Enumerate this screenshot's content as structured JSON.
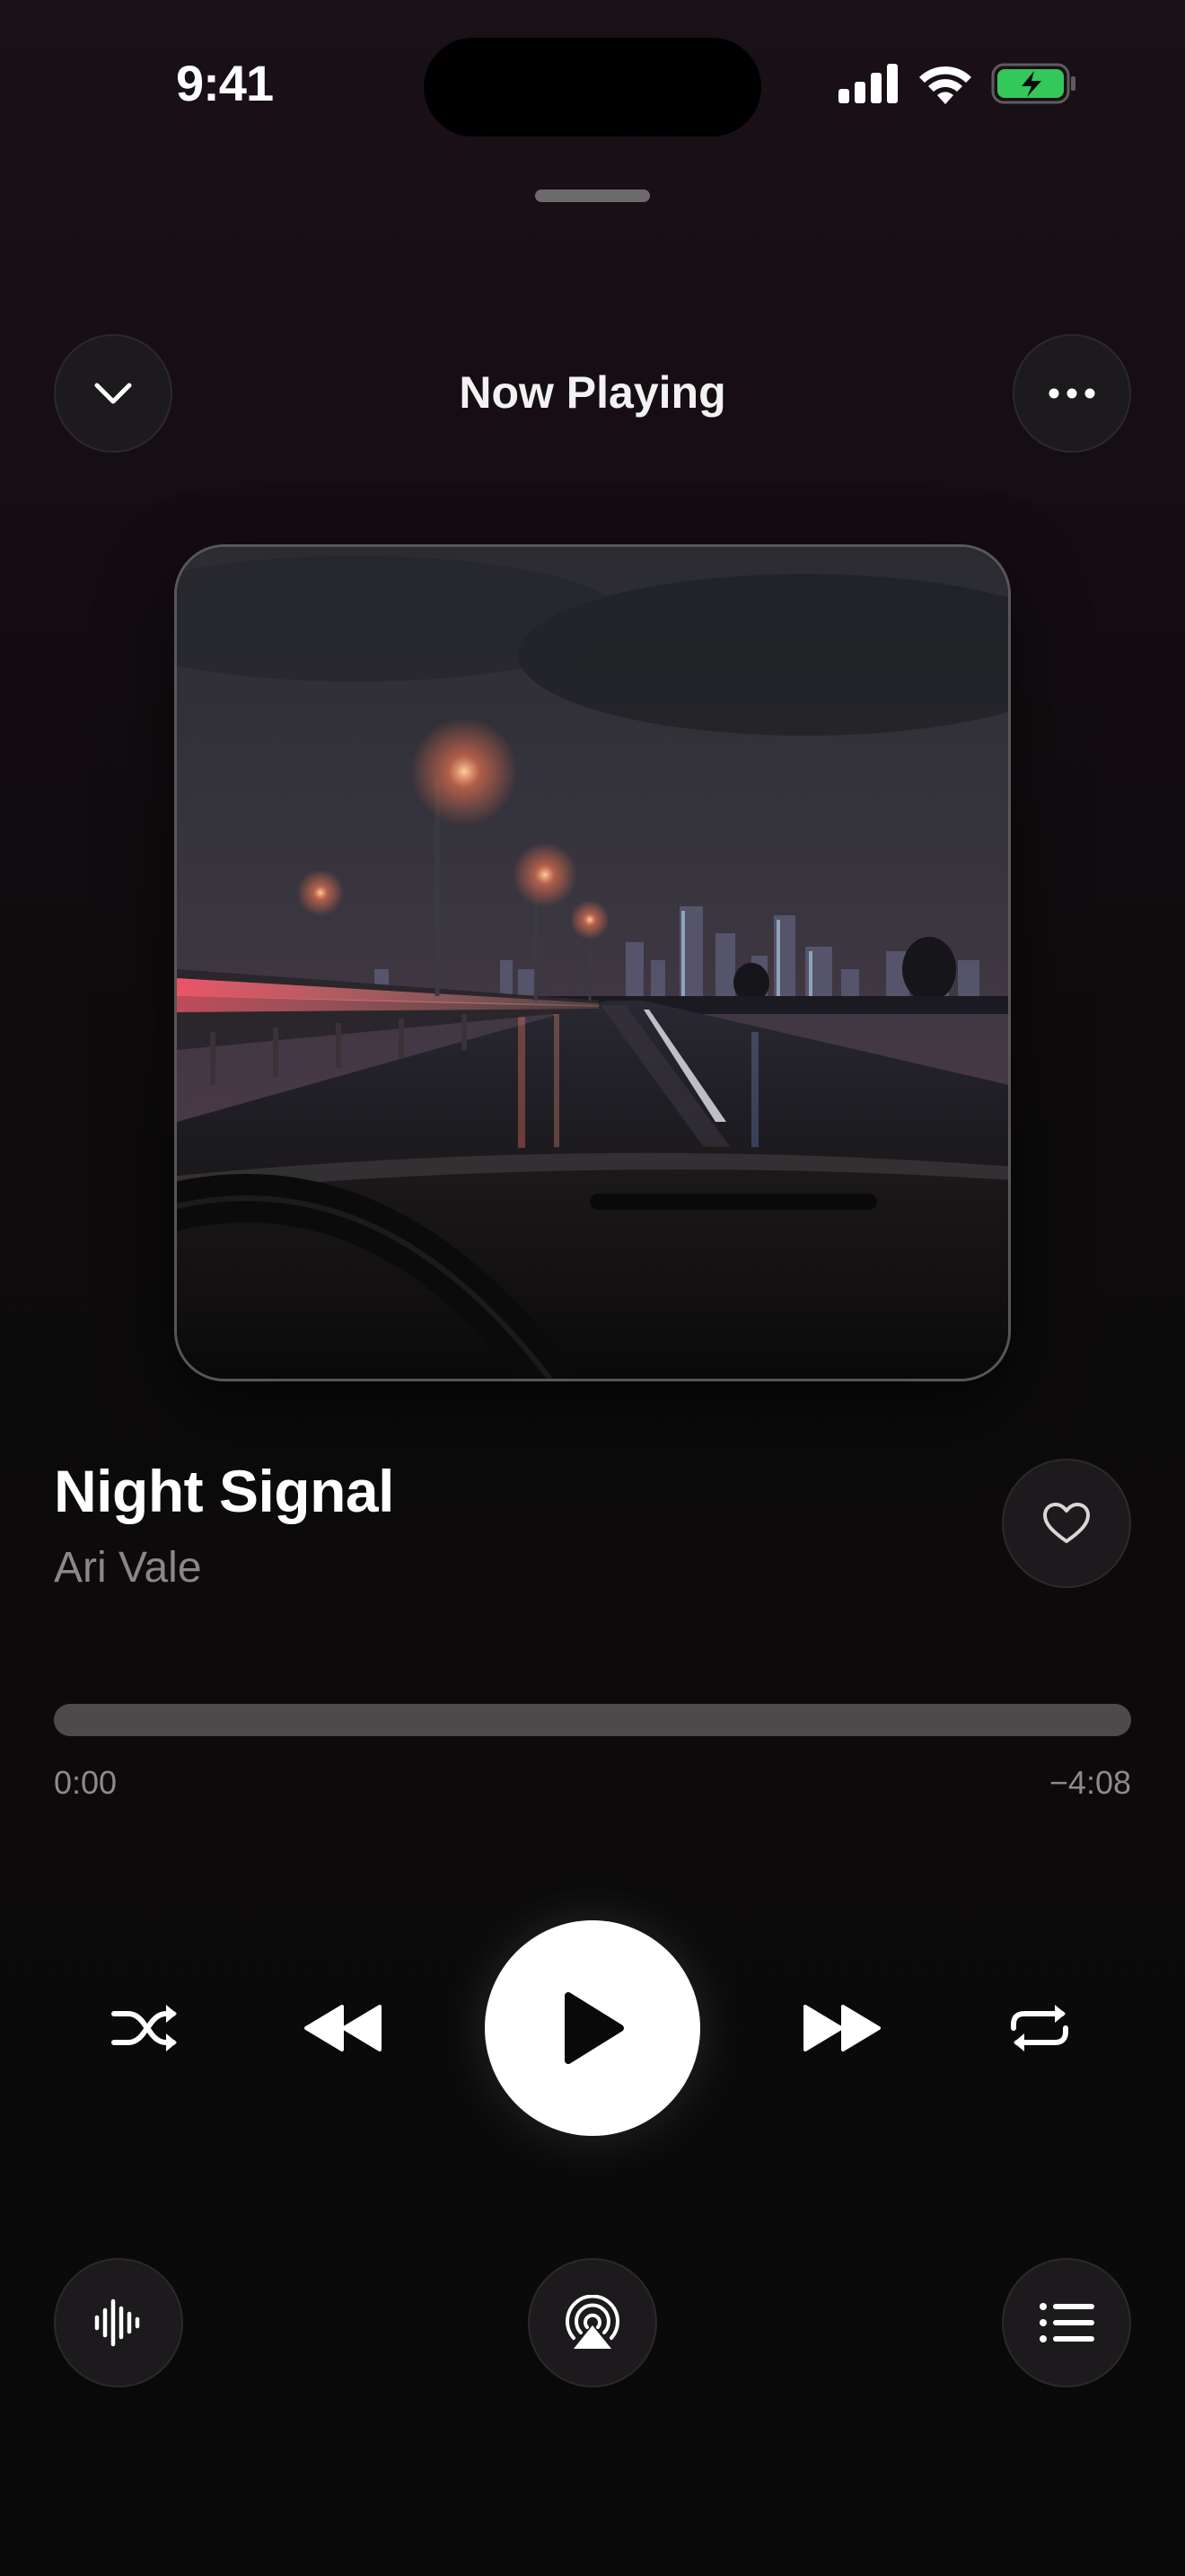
{
  "status_bar": {
    "time": "9:41",
    "icons": [
      "cellular-signal-icon",
      "wifi-icon",
      "battery-charging-icon"
    ],
    "battery_color": "#34c759"
  },
  "header": {
    "title": "Now Playing",
    "left_button_icon": "chevron-down-icon",
    "right_button_icon": "more-horizontal-icon"
  },
  "artwork": {
    "scene": "rainy-night-highway-city-skyline"
  },
  "track": {
    "title": "Night Signal",
    "artist": "Ari Vale",
    "favorite_icon": "heart-outline-icon",
    "favorited": false
  },
  "progress": {
    "elapsed": "0:00",
    "remaining": "−4:08",
    "fraction": 0
  },
  "controls": {
    "items": [
      "shuffle-icon",
      "previous-icon",
      "play-icon",
      "next-icon",
      "repeat-icon"
    ],
    "state": "paused"
  },
  "bottom_bar": {
    "items": [
      "waveform-icon",
      "airplay-icon",
      "queue-list-icon"
    ]
  },
  "colors": {
    "background_top": "#1a1118",
    "background_bottom": "#0a0909",
    "accent": "#ffffff",
    "secondary_text": "#8a8789"
  }
}
